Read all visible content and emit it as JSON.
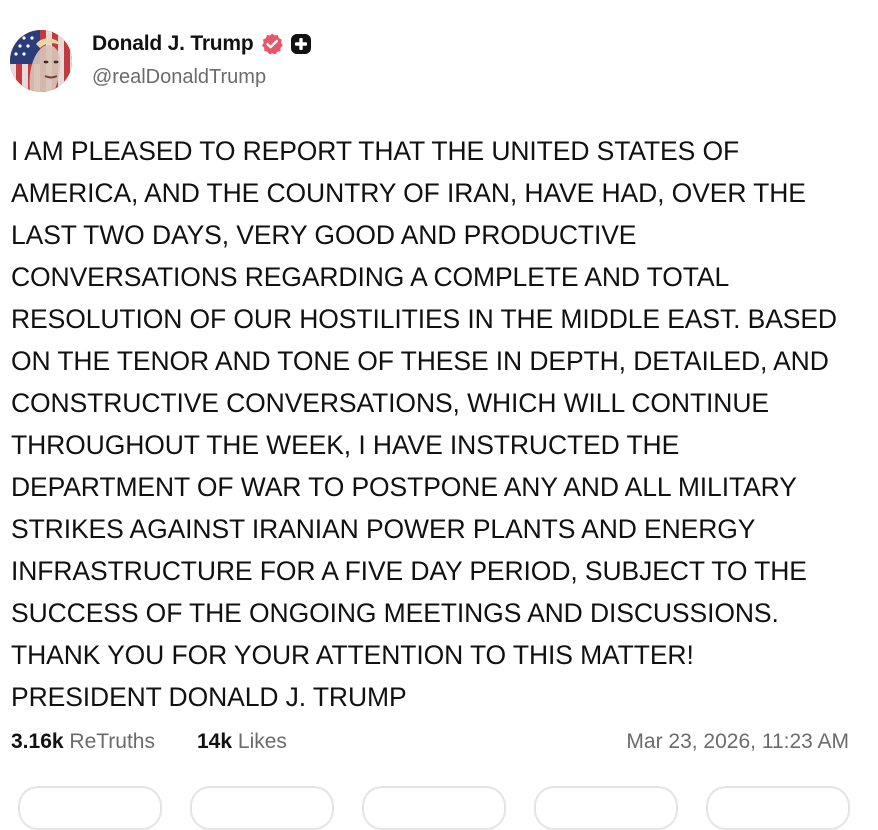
{
  "author": {
    "display_name": "Donald J. Trump",
    "handle": "@realDonaldTrump",
    "avatar": "avatar-portrait",
    "verified_icon": "verified-badge-icon",
    "plus_icon": "plus-badge-icon",
    "verified_color": "#e9566a"
  },
  "post": {
    "text": "I AM PLEASED TO REPORT THAT THE UNITED STATES OF\nAMERICA, AND THE COUNTRY OF IRAN, HAVE HAD, OVER THE\nLAST TWO DAYS, VERY GOOD AND PRODUCTIVE\nCONVERSATIONS REGARDING A COMPLETE AND TOTAL\nRESOLUTION OF OUR HOSTILITIES IN THE MIDDLE EAST. BASED\nON THE TENOR AND TONE OF THESE IN DEPTH, DETAILED, AND\nCONSTRUCTIVE CONVERSATIONS, WHICH WILL CONTINUE\nTHROUGHOUT THE WEEK, I HAVE INSTRUCTED THE\nDEPARTMENT OF WAR TO POSTPONE ANY AND ALL MILITARY\nSTRIKES AGAINST IRANIAN POWER PLANTS AND ENERGY\nINFRASTRUCTURE FOR A FIVE DAY PERIOD, SUBJECT TO THE\nSUCCESS OF THE ONGOING MEETINGS AND DISCUSSIONS.\nTHANK YOU FOR YOUR ATTENTION TO THIS MATTER!\nPRESIDENT DONALD J. TRUMP"
  },
  "stats": {
    "retruths_count": "3.16k",
    "retruths_label": "ReTruths",
    "likes_count": "14k",
    "likes_label": "Likes",
    "timestamp": "Mar 23, 2026, 11:23 AM"
  },
  "actions": {
    "count": 5
  }
}
